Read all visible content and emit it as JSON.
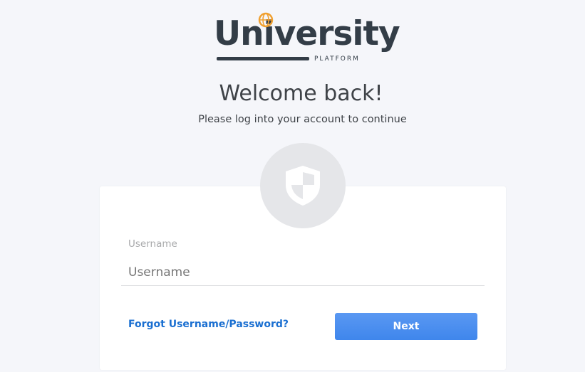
{
  "logo": {
    "word": "University",
    "sub": "PLATFORM",
    "accent_color": "#f0a030",
    "text_color": "#333d47"
  },
  "heading": "Welcome back!",
  "subtitle": "Please log into your account to continue",
  "form": {
    "icon": "shield-icon",
    "username_label": "Username",
    "username_placeholder": "Username",
    "username_value": "",
    "forgot_link": "Forgot Username/Password?",
    "next_button": "Next"
  },
  "colors": {
    "background": "#f5f6fa",
    "link": "#1a6fd1",
    "button": "#4a8ff0"
  }
}
